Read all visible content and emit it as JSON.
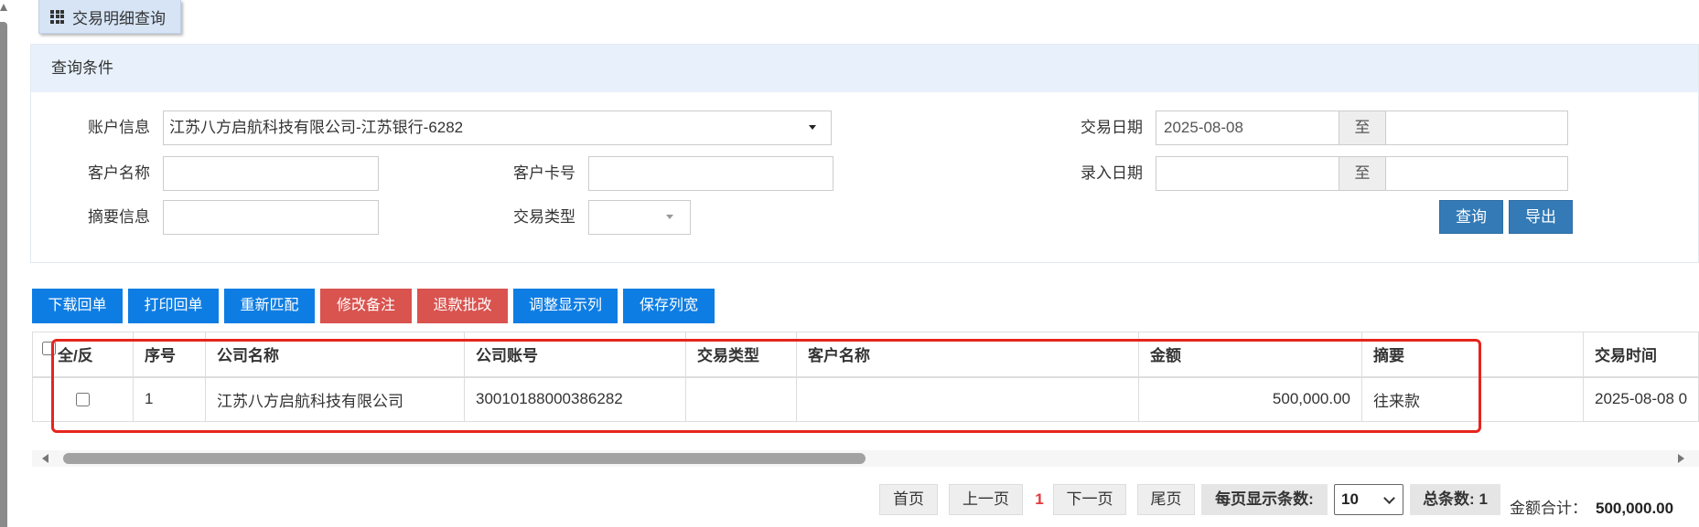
{
  "tab": {
    "title": "交易明细查询",
    "icon": "grid-icon"
  },
  "query_panel": {
    "title": "查询条件",
    "account": {
      "label": "账户信息",
      "value": "江苏八方启航科技有限公司-江苏银行-6282"
    },
    "customer_name": {
      "label": "客户名称",
      "value": ""
    },
    "customer_card": {
      "label": "客户卡号",
      "value": ""
    },
    "summary": {
      "label": "摘要信息",
      "value": ""
    },
    "trade_type": {
      "label": "交易类型",
      "value": ""
    },
    "trade_date": {
      "label": "交易日期",
      "from": "2025-08-08",
      "to": ""
    },
    "entry_date": {
      "label": "录入日期",
      "from": "",
      "to": ""
    },
    "range_separator": "至",
    "query_button": "查询",
    "export_button": "导出"
  },
  "toolbar": {
    "buttons": [
      {
        "label": "下载回单",
        "style": "primary"
      },
      {
        "label": "打印回单",
        "style": "primary"
      },
      {
        "label": "重新匹配",
        "style": "primary"
      },
      {
        "label": "修改备注",
        "style": "danger"
      },
      {
        "label": "退款批改",
        "style": "danger"
      },
      {
        "label": "调整显示列",
        "style": "primary"
      },
      {
        "label": "保存列宽",
        "style": "primary"
      }
    ]
  },
  "table": {
    "select_all_label": "全/反",
    "select_all_checked": false,
    "columns": [
      "序号",
      "公司名称",
      "公司账号",
      "交易类型",
      "客户名称",
      "金额",
      "摘要",
      "交易时间"
    ],
    "rows": [
      {
        "checked": false,
        "seq": "1",
        "company_name": "江苏八方启航科技有限公司",
        "company_account": "30010188000386282",
        "trade_type": "",
        "customer_name": "",
        "amount": "500,000.00",
        "summary": "往来款",
        "trade_time": "2025-08-08 0"
      }
    ]
  },
  "pagination": {
    "first": "首页",
    "prev": "上一页",
    "current_page": "1",
    "next": "下一页",
    "last": "尾页",
    "page_size_label": "每页显示条数:",
    "page_size": "10",
    "total_label": "总条数:",
    "total_count": "1",
    "amount_total_label": "金额合计：",
    "amount_total": "500,000.00"
  },
  "colors": {
    "tab_bg": "#d6e4f6",
    "panel_header_bg": "#e8f1fb",
    "query_button": "#337ab7",
    "toolbar_primary": "#0e7de3",
    "toolbar_danger": "#d9534f",
    "highlight_annotation": "#e5251d",
    "current_page": "#e4393c"
  }
}
